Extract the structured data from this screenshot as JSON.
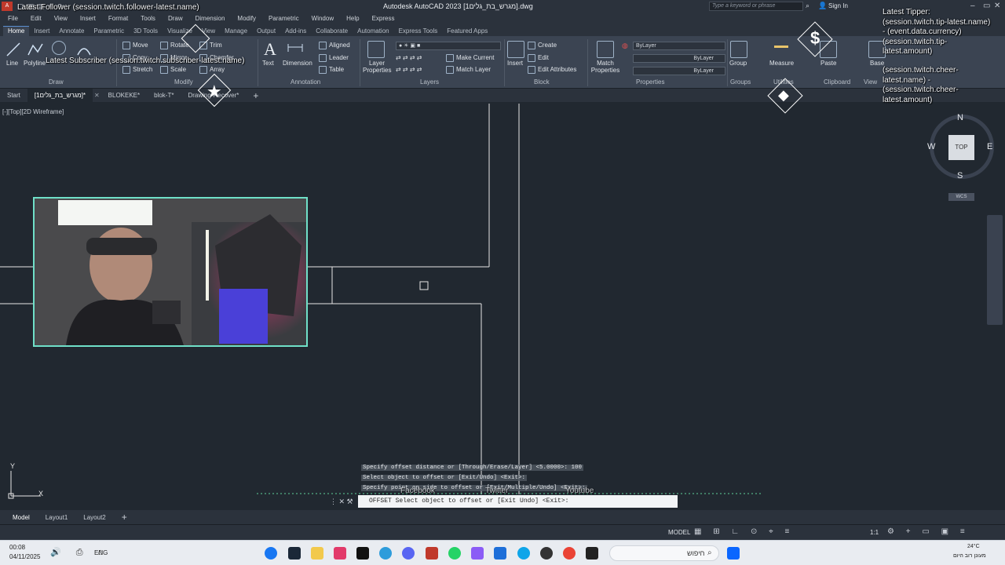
{
  "app": {
    "title": "Autodesk AutoCAD 2023   [מגרש_בת_גלים1].dwg",
    "logo": "A",
    "search_placeholder": "Type a keyword or phrase",
    "sign_in": "Sign In"
  },
  "menubar": [
    "File",
    "Edit",
    "View",
    "Insert",
    "Format",
    "Tools",
    "Draw",
    "Dimension",
    "Modify",
    "Parametric",
    "Window",
    "Help",
    "Express"
  ],
  "ribbon_tabs": [
    "Home",
    "Insert",
    "Annotate",
    "Parametric",
    "3D Tools",
    "Visualize",
    "View",
    "Manage",
    "Output",
    "Add-ins",
    "Collaborate",
    "Automation",
    "Express Tools",
    "Featured Apps"
  ],
  "ribbon": {
    "draw": {
      "title": "Draw",
      "line": "Line",
      "polyline": "Polyline"
    },
    "modify": {
      "title": "Modify",
      "move": "Move",
      "rotate": "Rotate",
      "trim": "Trim",
      "copy": "Copy",
      "mirror": "Mirror",
      "fillet": "Chamfer",
      "stretch": "Stretch",
      "scale": "Scale",
      "array": "Array"
    },
    "annotation": {
      "title": "Annotation",
      "text": "Text",
      "dimension": "Dimension",
      "aligned": "Aligned",
      "leader": "Leader",
      "table": "Table"
    },
    "layers": {
      "title": "Layers",
      "layer_properties": "Layer Properties",
      "make_current": "Make Current",
      "match_layer": "Match Layer"
    },
    "block": {
      "title": "Block",
      "insert": "Insert",
      "create": "Create",
      "edit": "Edit",
      "edit_attributes": "Edit Attributes"
    },
    "properties": {
      "title": "Properties",
      "match_properties": "Match Properties",
      "bylayer1": "ByLayer",
      "bylayer2": "ByLayer",
      "bylayer3": "ByLayer"
    },
    "groups": {
      "title": "Groups",
      "group": "Group"
    },
    "utilities": {
      "title": "Utilities",
      "measure": "Measure"
    },
    "clipboard": {
      "title": "Clipboard",
      "paste": "Paste"
    },
    "view": {
      "title": "View",
      "base": "Base"
    }
  },
  "file_tabs": [
    "Start",
    "[מגרש_בת_גלים1]*",
    "BLOKEKE*",
    "blok-T*",
    "Drawing-Recover*"
  ],
  "viewport": {
    "label": "[-][Top][2D Wireframe]"
  },
  "viewcube": {
    "north": "N",
    "south": "S",
    "east": "E",
    "west": "W",
    "top": "TOP",
    "wcs": "WCS"
  },
  "ucs": {
    "y": "Y",
    "x": "X"
  },
  "command": {
    "history": [
      "Specify offset distance or [Through/Erase/Layer] <5.0000>: 100",
      "Select object to offset or [Exit/Undo] <Exit>:",
      "Specify point on side to offset or [Exit/Multiple/Undo] <Exit>:"
    ],
    "prompt": "OFFSET Select object to offset or [Exit Undo] <Exit>:"
  },
  "layout_tabs": [
    "Model",
    "Layout1",
    "Layout2"
  ],
  "status": {
    "model": "MODEL",
    "scale": "1:1"
  },
  "taskbar": {
    "time": "00:08",
    "date": "04/11/2025",
    "lang": "ENG",
    "search": "חיפוש",
    "weather_temp": "24°C",
    "weather_desc": "מעונן רוב היום"
  },
  "overlay": {
    "follower": "Latest Follower (session.twitch.follower-latest.name)",
    "subscriber": "Latest Subscriber (session.twitch.subscriber-latest.name)",
    "tipper": "Latest Tipper: (session.twitch.tip-latest.name) - (event.data.currency) (session.twitch.tip-latest.amount)",
    "cheer": "(session.twitch.cheer-latest.name) - (session.twitch.cheer-latest.amount)",
    "socials": [
      "Facebook",
      "Twitter",
      "Youtube"
    ]
  },
  "colors": {
    "accent": "#5b8fd1",
    "webcam_border": "#6fe0c8",
    "bg": "#212830"
  }
}
